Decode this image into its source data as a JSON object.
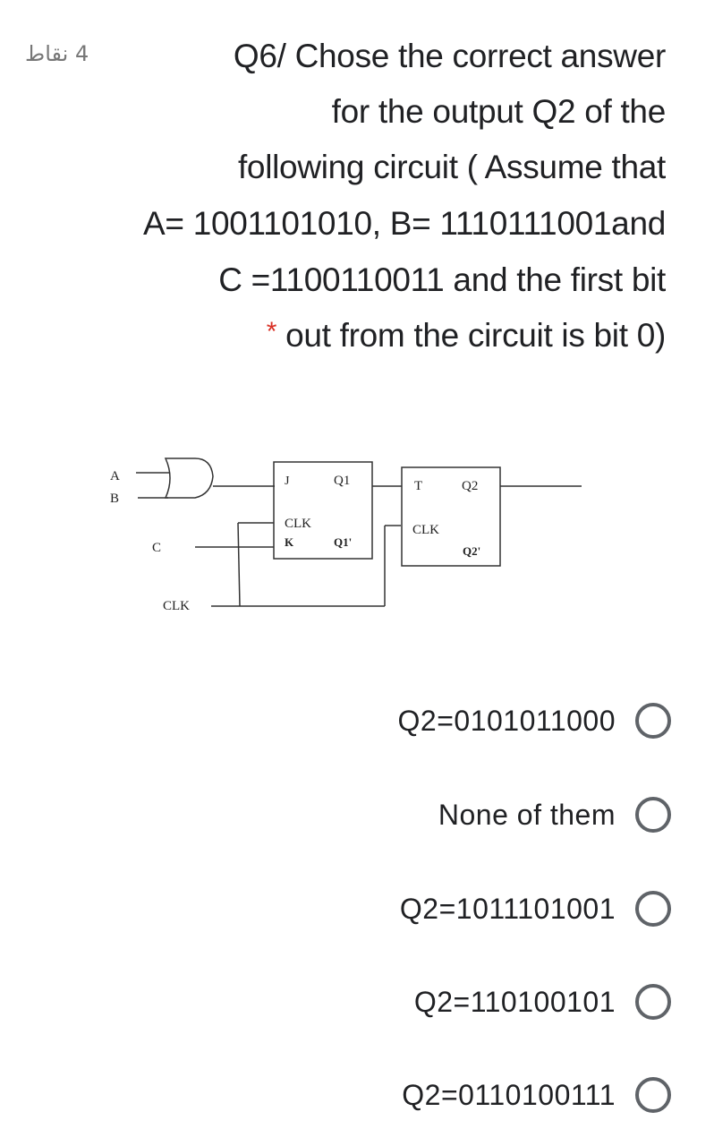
{
  "question": {
    "points": "4 نقاط",
    "lines": [
      "Q6/ Chose the correct answer",
      "for the output Q2 of the",
      "following circuit ( Assume that",
      "A= 1001101010, B= 1110111001and",
      "C =1100110011 and the first bit",
      "out from the circuit is bit 0)"
    ],
    "required_marker": "*"
  },
  "diagram": {
    "inputs": {
      "a": "A",
      "b": "B",
      "c": "C",
      "clk": "CLK"
    },
    "ff1": {
      "j": "J",
      "q": "Q1",
      "clk": "CLK",
      "k": "K",
      "qn": "Q1'"
    },
    "ff2": {
      "t": "T",
      "q": "Q2",
      "clk": "CLK",
      "qn": "Q2'"
    }
  },
  "options": [
    {
      "label": "Q2=0101011000",
      "selected": false
    },
    {
      "label": "None of them",
      "selected": false
    },
    {
      "label": "Q2=1011101001",
      "selected": false
    },
    {
      "label": "Q2=110100101",
      "selected": false
    },
    {
      "label": "Q2=0110100111",
      "selected": false
    }
  ]
}
